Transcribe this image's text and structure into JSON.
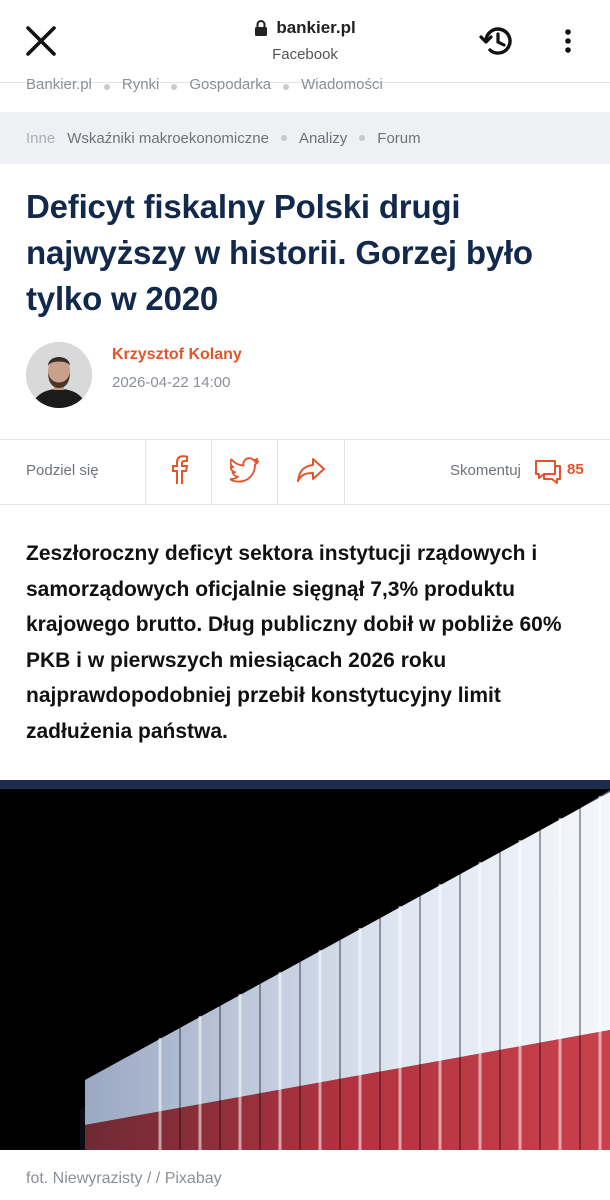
{
  "browser": {
    "domain": "bankier.pl",
    "source": "Facebook",
    "icons": {
      "close": "close-icon",
      "lock": "lock-icon",
      "history": "history-icon",
      "menu": "more-vertical-icon"
    }
  },
  "nav": {
    "primary": [
      "Bankier.pl",
      "Rynki",
      "Gospodarka",
      "Wiadomości"
    ],
    "secondary": {
      "current": "Inne",
      "links": [
        "Wskaźniki makroekonomiczne",
        "Analizy",
        "Forum"
      ]
    }
  },
  "article": {
    "title": "Deficyt fiskalny Polski drugi najwyższy w historii. Gorzej było tylko w 2020",
    "author": "Krzysztof Kolany",
    "date": "2026-04-22 14:00",
    "lead": "Zeszłoroczny deficyt sektora instytucji rządowych i samorządowych oficjalnie sięgnął 7,3% produktu krajowego brutto. Dług publiczny dobił w pobliże 60% PKB i w pierwszych miesiącach 2026 roku najprawdopodobniej przebił konstytucyjny limit zadłużenia państwa.",
    "photo_caption": "fot. Niewyrazisty / / Pixabay"
  },
  "share": {
    "label": "Podziel się",
    "comment_label": "Skomentuj",
    "comment_count": "85",
    "icons": [
      "facebook-icon",
      "twitter-icon",
      "share-icon",
      "comment-icon"
    ]
  },
  "colors": {
    "headline": "#13294b",
    "accent": "#e2542a",
    "muted": "#8a8f97",
    "nav_bg": "#eef0f3"
  }
}
